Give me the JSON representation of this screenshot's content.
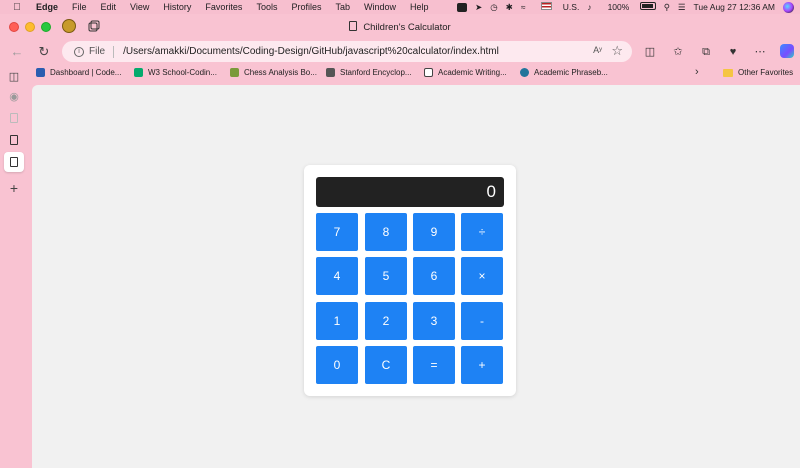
{
  "menubar": {
    "app": "Edge",
    "items": [
      "File",
      "Edit",
      "View",
      "History",
      "Favorites",
      "Tools",
      "Profiles",
      "Tab",
      "Window",
      "Help"
    ],
    "status": {
      "keyboard": "U.S.",
      "battery": "100%",
      "datetime": "Tue Aug 27  12:36 AM"
    }
  },
  "window": {
    "tab_title": "Children's Calculator"
  },
  "toolbar": {
    "file_label": "File",
    "url": "/Users/amakki/Documents/Coding-Design/GitHub/javascript%20calculator/index.html",
    "read_aloud": "Aʸ"
  },
  "favorites": {
    "items": [
      "Dashboard | Code...",
      "W3 School-Codin...",
      "Chess Analysis Bo...",
      "Stanford Encyclop...",
      "Academic Writing...",
      "Academic Phraseb..."
    ],
    "other": "Other Favorites"
  },
  "calculator": {
    "display": "0",
    "keys": [
      "7",
      "8",
      "9",
      "÷",
      "4",
      "5",
      "6",
      "×",
      "1",
      "2",
      "3",
      "-",
      "0",
      "C",
      "=",
      "+"
    ]
  },
  "colors": {
    "browser_bg": "#f9c3d2",
    "key": "#1e82f4",
    "display": "#222222",
    "page_bg": "#f1f1f1"
  }
}
